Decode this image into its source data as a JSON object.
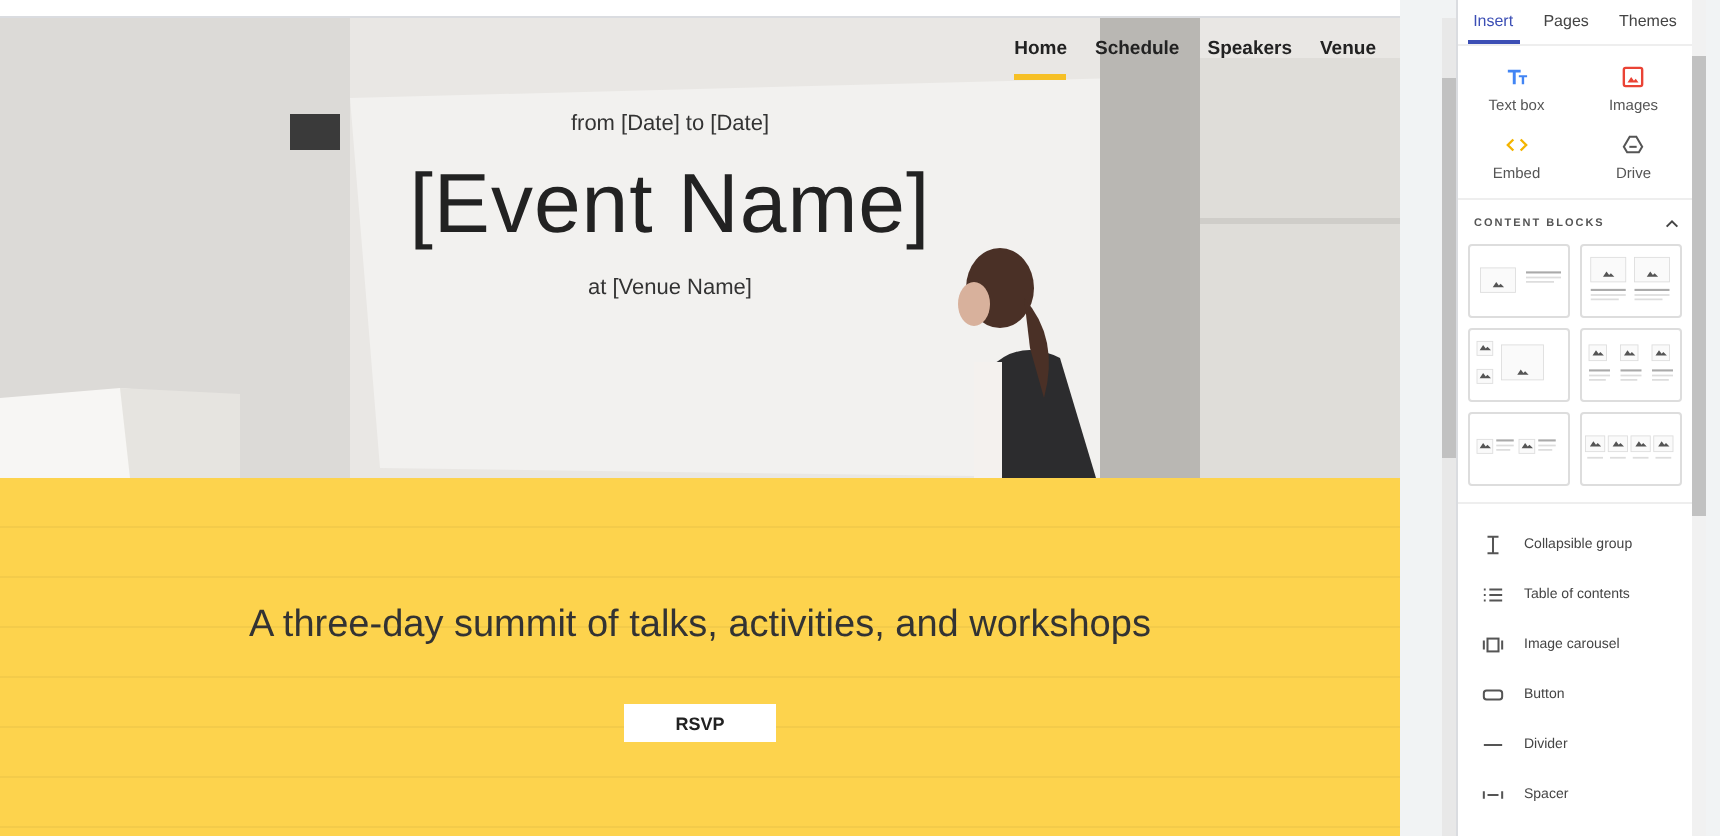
{
  "nav": [
    {
      "label": "Home",
      "selected": true
    },
    {
      "label": "Schedule",
      "selected": false
    },
    {
      "label": "Speakers",
      "selected": false
    },
    {
      "label": "Venue",
      "selected": false
    }
  ],
  "hero": {
    "dates": "from [Date] to [Date]",
    "title": "[Event Name]",
    "venue": "at [Venue Name]"
  },
  "section": {
    "tagline": "A three-day summit of talks, activities, and workshops",
    "button": "RSVP"
  },
  "panel": {
    "tabs": [
      {
        "label": "Insert",
        "selected": true
      },
      {
        "label": "Pages",
        "selected": false
      },
      {
        "label": "Themes",
        "selected": false
      }
    ],
    "insert": [
      {
        "kind": "textbox",
        "label": "Text box"
      },
      {
        "kind": "images",
        "label": "Images"
      },
      {
        "kind": "embed",
        "label": "Embed"
      },
      {
        "kind": "drive",
        "label": "Drive"
      }
    ],
    "blocks_title": "CONTENT BLOCKS",
    "blocks_expanded": true,
    "blocks": [
      {
        "kind": "image-text"
      },
      {
        "kind": "two-images"
      },
      {
        "kind": "image-stack"
      },
      {
        "kind": "three-images"
      },
      {
        "kind": "two-image-text"
      },
      {
        "kind": "four-images"
      }
    ],
    "items": [
      {
        "kind": "collapsible",
        "label": "Collapsible group"
      },
      {
        "kind": "toc",
        "label": "Table of contents"
      },
      {
        "kind": "carousel",
        "label": "Image carousel"
      },
      {
        "kind": "button",
        "label": "Button"
      },
      {
        "kind": "divider",
        "label": "Divider"
      },
      {
        "kind": "spacer",
        "label": "Spacer"
      }
    ]
  }
}
